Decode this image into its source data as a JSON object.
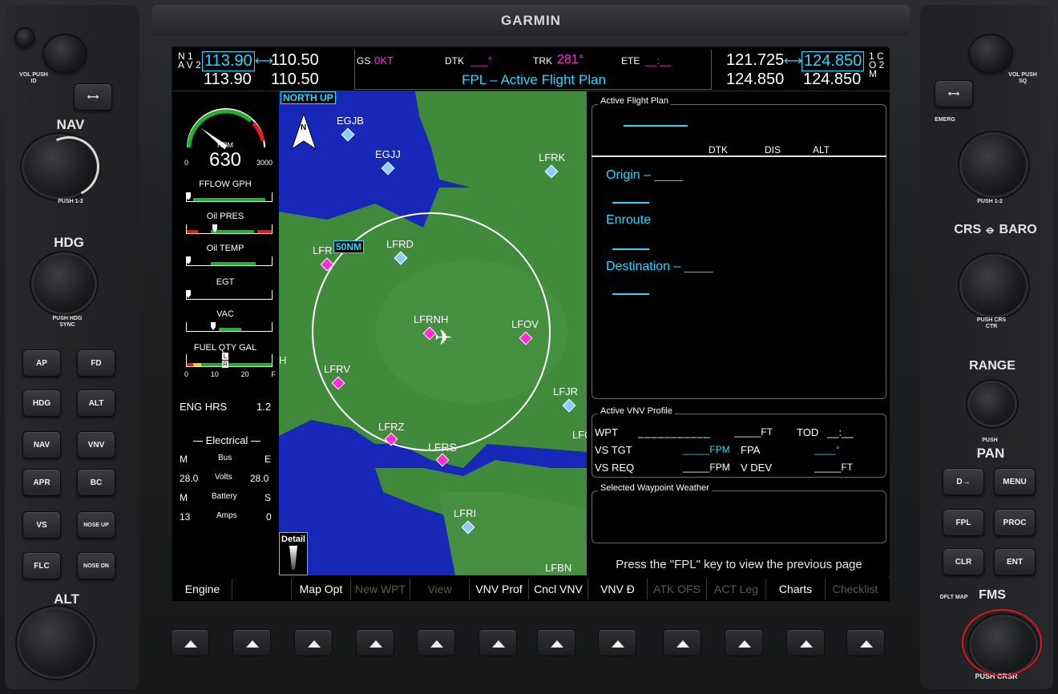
{
  "brand": "GARMIN",
  "left_controls": {
    "vol_push": "VOL",
    "vol_push_sub": "PUSH ID",
    "nav_label": "NAV",
    "nav_push": "PUSH 1-2",
    "hdg_label": "HDG",
    "hdg_push": "PUSH HDG SYNC",
    "alt_label": "ALT",
    "buttons": [
      {
        "label": "AP"
      },
      {
        "label": "FD"
      },
      {
        "label": "HDG"
      },
      {
        "label": "ALT"
      },
      {
        "label": "NAV"
      },
      {
        "label": "VNV"
      },
      {
        "label": "APR"
      },
      {
        "label": "BC"
      },
      {
        "label": "VS"
      },
      {
        "label": "NOSE UP"
      },
      {
        "label": "FLC"
      },
      {
        "label": "NOSE DN"
      }
    ]
  },
  "right_controls": {
    "vol_push": "VOL",
    "vol_push_sub": "PUSH SQ",
    "emerg": "EMERG",
    "push_12": "PUSH 1-2",
    "crs": "CRS",
    "baro": "BARO",
    "crs_ctr": "PUSH CRS CTR",
    "range": "RANGE",
    "push_pan": "PUSH",
    "pan": "PAN",
    "buttons": [
      {
        "label": "D→"
      },
      {
        "label": "MENU"
      },
      {
        "label": "FPL"
      },
      {
        "label": "PROC"
      },
      {
        "label": "CLR"
      },
      {
        "label": "ENT"
      }
    ],
    "dflt_map": "DFLT MAP",
    "fms": "FMS",
    "push_crsr": "PUSH CRSR"
  },
  "nav": {
    "line1_label": "N 1",
    "line2_label": "A V 2",
    "nav1_active": "113.90",
    "nav1_standby": "110.50",
    "nav2_active": "113.90",
    "nav2_standby": "110.50"
  },
  "com": {
    "com1_active": "121.725",
    "com1_standby": "124.850",
    "com2_active": "124.850",
    "com2_standby": "124.850",
    "line1_label": "1 C",
    "line2_label": "O 2 M"
  },
  "nav_data": {
    "gs_label": "GS",
    "gs_value": "0KT",
    "dtk_label": "DTK",
    "dtk_value": "___°",
    "trk_label": "TRK",
    "trk_value": "281°",
    "ete_label": "ETE",
    "ete_value": "__:__",
    "page_title": "FPL – Active Flight Plan"
  },
  "eis": {
    "rpm_label": "RPM",
    "rpm_value": "630",
    "rpm_value_num": 630,
    "rpm_min": "0",
    "rpm_max": "3000",
    "fflow_label": "FFLOW GPH",
    "oilpres_label": "Oil PRES",
    "oiltemp_label": "Oil TEMP",
    "egt_label": "EGT",
    "vac_label": "VAC",
    "fuel_label": "FUEL QTY GAL",
    "fuel_ticks": [
      "0",
      "10",
      "20",
      "F"
    ],
    "fuel_indicator_left": "L",
    "fuel_indicator_right": "R",
    "eng_hrs_label": "ENG HRS",
    "eng_hrs_value": "1.2",
    "electrical_label": "Electrical",
    "bus_label": "Bus",
    "bus_m": "M",
    "bus_e": "E",
    "volts_label": "Volts",
    "volts_m": "28.0",
    "volts_e": "28.0",
    "battery_label": "Battery",
    "battery_m": "M",
    "battery_s": "S",
    "amps_label": "Amps",
    "amps_m": "13",
    "amps_s": "0"
  },
  "map": {
    "orientation": "NORTH UP",
    "north_label": "N",
    "range_label": "50NM",
    "detail_label": "Detail",
    "waypoints": [
      {
        "id": "EGJB",
        "kind": "airport-blue"
      },
      {
        "id": "EGJJ",
        "kind": "airport-blue"
      },
      {
        "id": "LFRK",
        "kind": "airport-blue"
      },
      {
        "id": "LFR",
        "kind": "airport-magenta"
      },
      {
        "id": "LFRD",
        "kind": "airport-blue"
      },
      {
        "id": "LFRNH",
        "kind": "airport-magenta"
      },
      {
        "id": "LFOV",
        "kind": "airport-magenta"
      },
      {
        "id": "LFRV",
        "kind": "airport-magenta"
      },
      {
        "id": "LFJR",
        "kind": "airport-blue"
      },
      {
        "id": "LFRZ",
        "kind": "airport-magenta"
      },
      {
        "id": "LFRS",
        "kind": "airport-magenta"
      },
      {
        "id": "LFRI",
        "kind": "airport-blue"
      },
      {
        "id": "LFBN",
        "kind": "airport-blue"
      },
      {
        "id": "LFC",
        "kind": "airport-blue"
      },
      {
        "id": "H",
        "kind": "label"
      }
    ]
  },
  "fpl": {
    "active_title": "Active Flight Plan",
    "col_dtk": "DTK",
    "col_dis": "DIS",
    "col_alt": "ALT",
    "origin": "Origin – ____",
    "enroute": "Enroute",
    "destination": "Destination – ____",
    "vnv_title": "Active VNV Profile",
    "wpt_label": "WPT",
    "wpt_value": "___________",
    "wpt_alt": "_____FT",
    "tod_label": "TOD",
    "tod_value": "__:__",
    "vstgt_label": "VS TGT",
    "vstgt_value": "_____FPM",
    "fpa_label": "FPA",
    "fpa_value": "____°",
    "vsreq_label": "VS REQ",
    "vsreq_value": "_____FPM",
    "vdev_label": "V DEV",
    "vdev_value": "_____FT",
    "wx_title": "Selected Waypoint Weather",
    "hint": "Press the \"FPL\" key to view the previous page"
  },
  "softkeys": [
    {
      "label": "Engine",
      "enabled": true
    },
    {
      "label": "",
      "enabled": true
    },
    {
      "label": "Map Opt",
      "enabled": true
    },
    {
      "label": "New WPT",
      "enabled": false
    },
    {
      "label": "View",
      "enabled": false
    },
    {
      "label": "VNV Prof",
      "enabled": true
    },
    {
      "label": "Cncl VNV",
      "enabled": true
    },
    {
      "label": "VNV Đ",
      "enabled": true
    },
    {
      "label": "ATK OFS",
      "enabled": false
    },
    {
      "label": "ACT Leg",
      "enabled": false
    },
    {
      "label": "Charts",
      "enabled": true
    },
    {
      "label": "Checklist",
      "enabled": false
    }
  ],
  "colors": {
    "cyan": "#2ad7ff",
    "magenta": "#ff2ad8",
    "map_land": "#3f8a3b",
    "map_water": "#1727b8"
  }
}
